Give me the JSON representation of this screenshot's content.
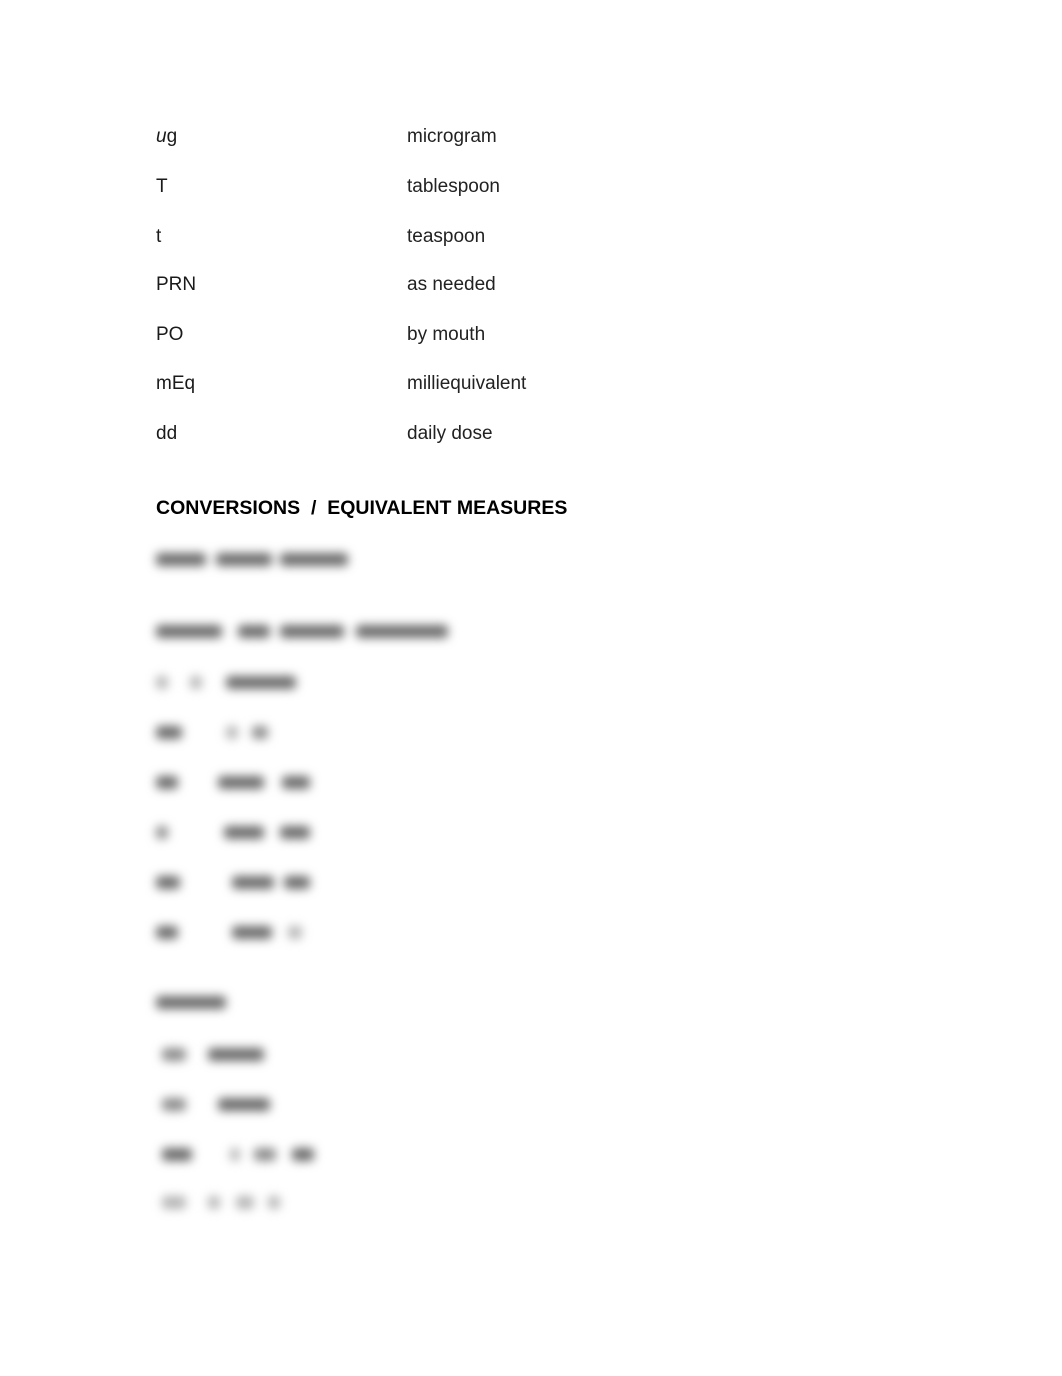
{
  "abbreviations": [
    {
      "term_italic": "u",
      "term_rest": "g",
      "definition": "microgram"
    },
    {
      "term_italic": "",
      "term_rest": "T",
      "definition": "tablespoon"
    },
    {
      "term_italic": "",
      "term_rest": "t",
      "definition": "teaspoon"
    },
    {
      "term_italic": "",
      "term_rest": "PRN",
      "definition": "as needed"
    },
    {
      "term_italic": "",
      "term_rest": "PO",
      "definition": "by mouth"
    },
    {
      "term_italic": "",
      "term_rest": "mEq",
      "definition": "milliequivalent"
    },
    {
      "term_italic": "",
      "term_rest": "dd",
      "definition": "daily dose"
    }
  ],
  "section_heading": "CONVERSIONS  /  EQUIVALENT MEASURES",
  "obscured_section": {
    "state": "blurred",
    "line_count": 15
  }
}
